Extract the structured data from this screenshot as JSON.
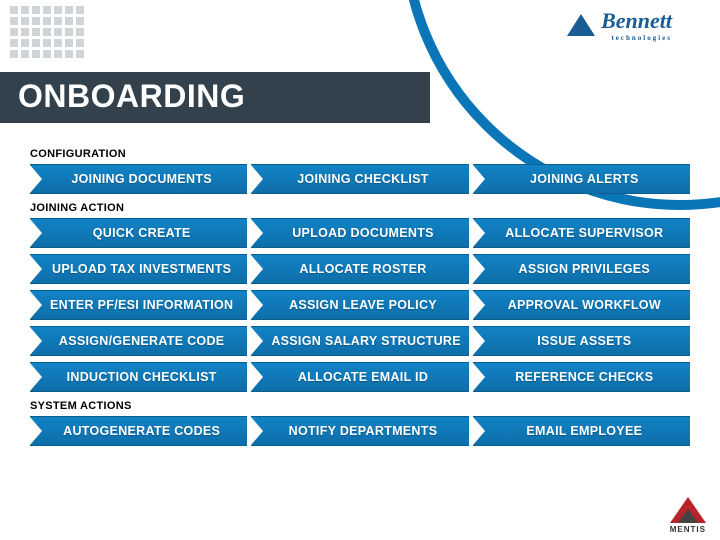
{
  "brand": {
    "name": "Bennett",
    "sub": "technologies"
  },
  "title": "ONBOARDING",
  "s1": {
    "label": "CONFIGURATION",
    "r1": [
      "JOINING DOCUMENTS",
      "JOINING CHECKLIST",
      "JOINING ALERTS"
    ]
  },
  "s2": {
    "label": "JOINING ACTION",
    "r1": [
      "QUICK CREATE",
      "UPLOAD DOCUMENTS",
      "ALLOCATE SUPERVISOR"
    ],
    "r2": [
      "UPLOAD TAX INVESTMENTS",
      "ALLOCATE ROSTER",
      "ASSIGN PRIVILEGES"
    ],
    "r3": [
      "ENTER PF/ESI INFORMATION",
      "ASSIGN LEAVE POLICY",
      "APPROVAL WORKFLOW"
    ],
    "r4": [
      "ASSIGN/GENERATE CODE",
      "ASSIGN SALARY STRUCTURE",
      "ISSUE ASSETS"
    ],
    "r5": [
      "INDUCTION CHECKLIST",
      "ALLOCATE EMAIL ID",
      "REFERENCE CHECKS"
    ]
  },
  "s3": {
    "label": "SYSTEM ACTIONS",
    "r1": [
      "AUTOGENERATE CODES",
      "NOTIFY DEPARTMENTS",
      "EMAIL EMPLOYEE"
    ]
  },
  "footer": {
    "brand": "MENTIS"
  }
}
